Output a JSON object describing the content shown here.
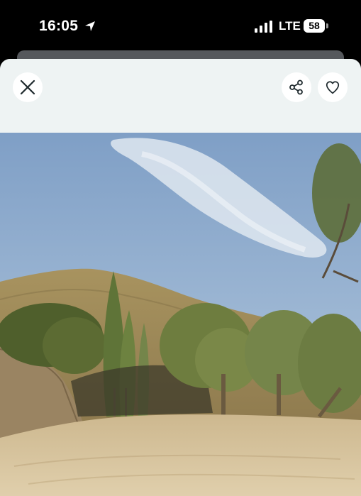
{
  "status_bar": {
    "time": "16:05",
    "network": "LTE",
    "battery": "58",
    "icons": [
      "location-arrow-icon",
      "signal-bars-icon",
      "battery-icon"
    ]
  },
  "header": {
    "close_icon": "close-icon",
    "share_icon": "share-icon",
    "favorite_icon": "heart-icon"
  },
  "photo": {
    "subject": "",
    "colors": {
      "sky_top": "#7f9fc6",
      "sky_bottom": "#b9cde0",
      "hill": "#a38d5e",
      "ground": "#d9c7a2",
      "foliage": "#6b7a3e"
    }
  }
}
